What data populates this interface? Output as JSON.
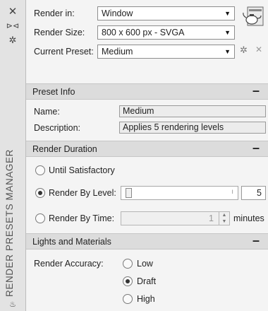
{
  "palette": {
    "title_bar": "#e3e3e3",
    "panel": "#f4f4f4",
    "section_header": "#dcdcdc"
  },
  "title_bar": {
    "title": "RENDER PRESETS MANAGER",
    "icons": [
      "close-icon",
      "pin-icon",
      "properties-icon",
      "teapot-icon"
    ]
  },
  "header": {
    "render_in_label": "Render in:",
    "render_in_value": "Window",
    "render_size_label": "Render Size:",
    "render_size_value": "800 x 600 px - SVGA",
    "current_preset_label": "Current Preset:",
    "current_preset_value": "Medium",
    "icons": [
      "teapot-render-icon",
      "gear-icon",
      "delete-icon"
    ]
  },
  "preset_info": {
    "title": "Preset Info",
    "collapse": "–",
    "name_label": "Name:",
    "name_value": "Medium",
    "description_label": "Description:",
    "description_value": "Applies 5 rendering levels"
  },
  "render_duration": {
    "title": "Render Duration",
    "collapse": "–",
    "until_satisfactory": "Until Satisfactory",
    "by_level_label": "Render By Level:",
    "by_level_value": "5",
    "by_time_label": "Render By Time:",
    "by_time_value": "1",
    "by_time_unit": "minutes",
    "selected": "Render By Level"
  },
  "lights_materials": {
    "title": "Lights and Materials",
    "collapse": "–",
    "accuracy_label": "Render Accuracy:",
    "options": [
      "Low",
      "Draft",
      "High"
    ],
    "selected": "Draft"
  }
}
